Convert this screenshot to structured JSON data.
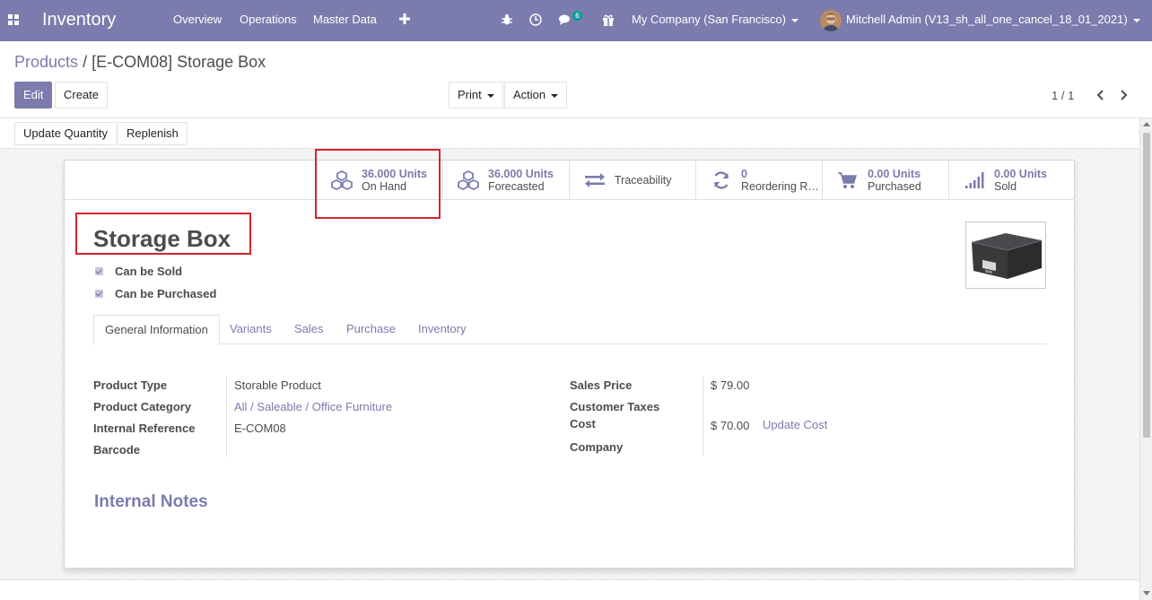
{
  "navbar": {
    "app_name": "Inventory",
    "menus": [
      "Overview",
      "Operations",
      "Master Data"
    ],
    "message_count": "6",
    "company": "My Company (San Francisco)",
    "user": "Mitchell Admin (V13_sh_all_one_cancel_18_01_2021)",
    "icons": [
      "apps-icon",
      "plus-icon",
      "bug-icon",
      "clock-icon",
      "chat-icon",
      "gift-icon"
    ],
    "color": "#7c7bad"
  },
  "breadcrumb": {
    "parent": "Products",
    "separator": "/",
    "current": "[E-COM08] Storage Box"
  },
  "toolbar": {
    "edit": "Edit",
    "create": "Create",
    "print": "Print",
    "action": "Action",
    "pager": "1 / 1"
  },
  "statusbar": {
    "update_quantity": "Update Quantity",
    "replenish": "Replenish"
  },
  "smart_buttons": [
    {
      "value": "36.000 Units",
      "label": "On Hand",
      "icon": "cubes-icon"
    },
    {
      "value": "36.000 Units",
      "label": "Forecasted",
      "icon": "cubes-icon"
    },
    {
      "value": "",
      "label": "Traceability",
      "icon": "exchange-icon"
    },
    {
      "value": "0",
      "label": "Reordering Rules",
      "icon": "refresh-icon"
    },
    {
      "value": "0.00 Units",
      "label": "Purchased",
      "icon": "cart-icon"
    },
    {
      "value": "0.00 Units",
      "label": "Sold",
      "icon": "signal-icon"
    }
  ],
  "product": {
    "name": "Storage Box",
    "can_be_sold": "Can be Sold",
    "can_be_purchased": "Can be Purchased"
  },
  "tabs": [
    "General Information",
    "Variants",
    "Sales",
    "Purchase",
    "Inventory"
  ],
  "general": {
    "left": [
      {
        "label": "Product Type",
        "value": "Storable Product"
      },
      {
        "label": "Product Category",
        "value": "All / Saleable / Office Furniture"
      },
      {
        "label": "Internal Reference",
        "value": "E-COM08"
      },
      {
        "label": "Barcode",
        "value": ""
      }
    ],
    "right": [
      {
        "label": "Sales Price",
        "value": "$ 79.00"
      },
      {
        "label": "Customer Taxes",
        "value": ""
      },
      {
        "label": "Cost",
        "value": "$ 70.00"
      },
      {
        "label": "Company",
        "value": ""
      }
    ],
    "update_cost": "Update Cost"
  },
  "internal_notes": "Internal Notes",
  "highlight_color": "#d9232b"
}
